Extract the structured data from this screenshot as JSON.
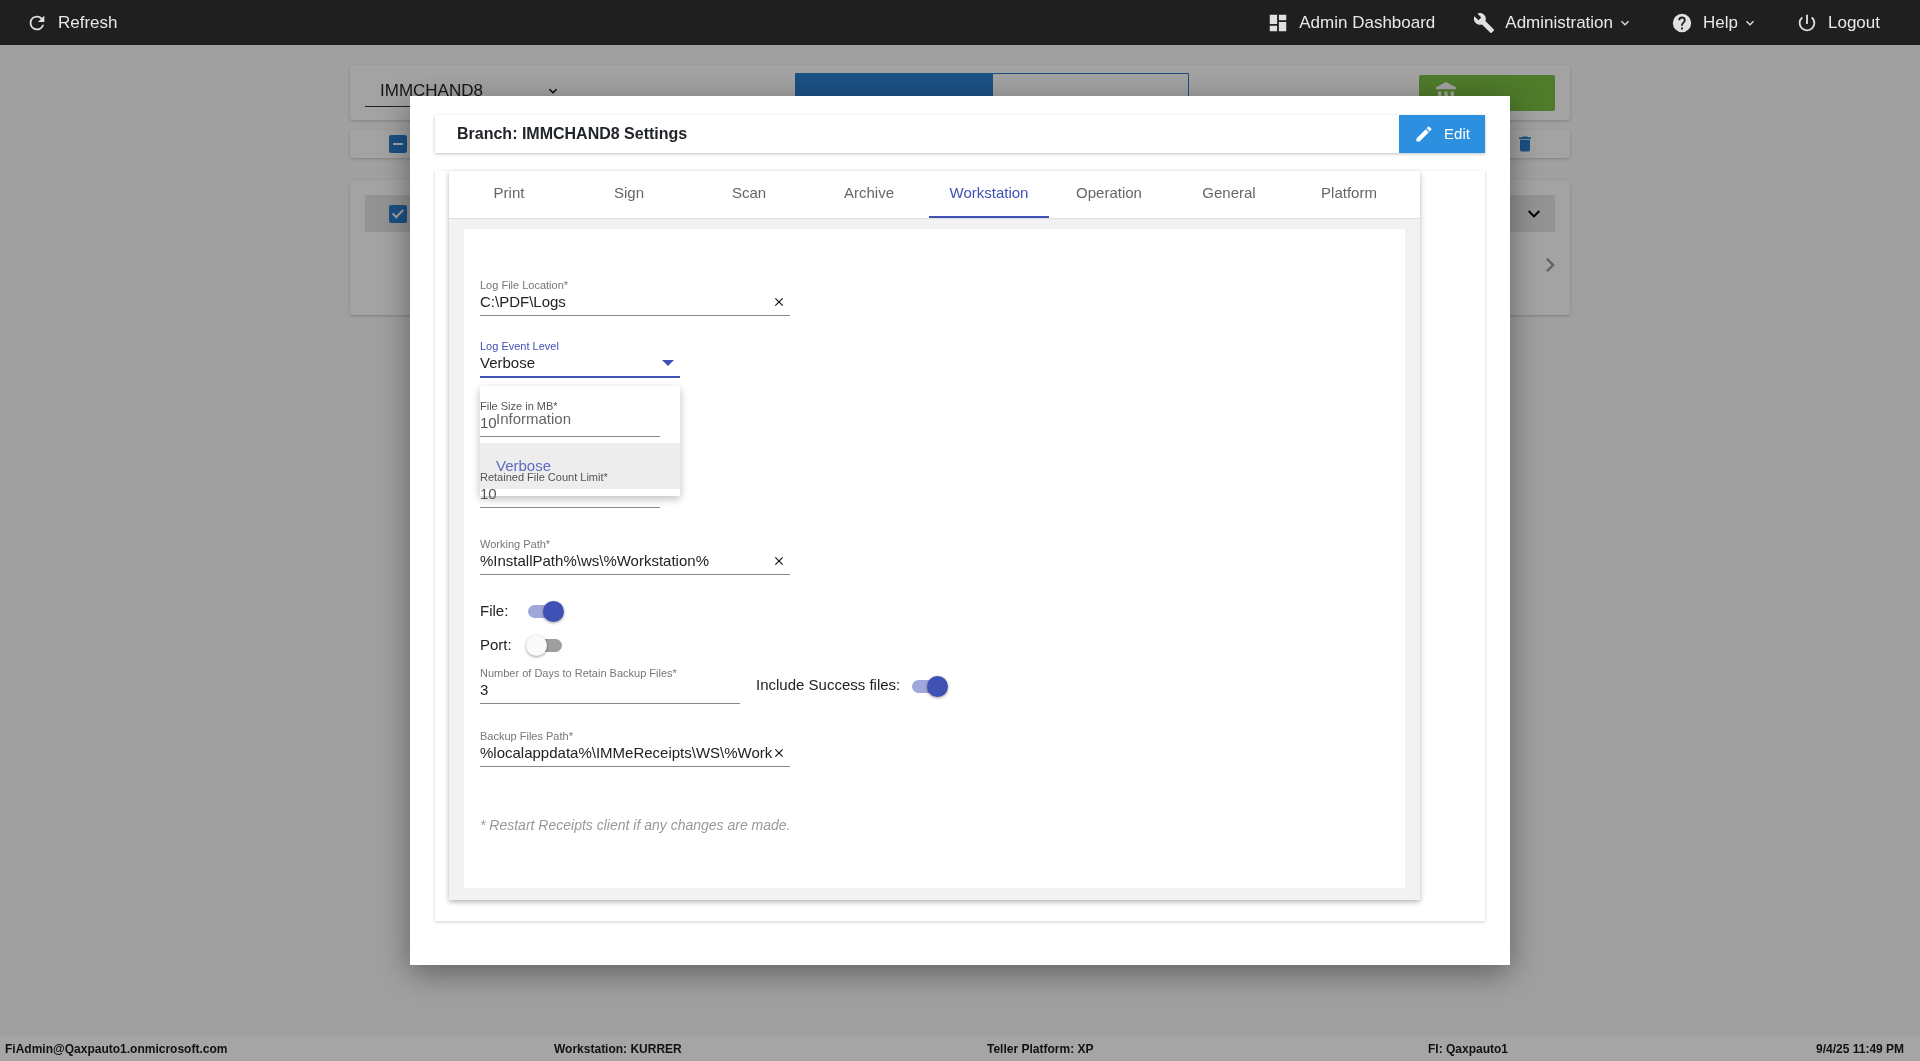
{
  "top_bar": {
    "left": [
      {
        "label": "Refresh"
      }
    ],
    "right": [
      {
        "label": "Admin Dashboard",
        "kind": "link"
      },
      {
        "label": "Administration",
        "kind": "menu"
      },
      {
        "label": "Help",
        "kind": "menu"
      },
      {
        "label": "Logout",
        "kind": "link"
      }
    ]
  },
  "background": {
    "branch_select": "IMMCHAND8",
    "view_tabs": [
      {
        "selected": true
      },
      {
        "selected": false
      }
    ],
    "select_all": {
      "indeterminate": true
    },
    "row": {
      "checked": true
    }
  },
  "dialog": {
    "title": "Branch: IMMCHAND8 Settings",
    "edit_button": "Edit",
    "tabs": [
      {
        "label": "Print",
        "selected": false
      },
      {
        "label": "Sign",
        "selected": false
      },
      {
        "label": "Scan",
        "selected": false
      },
      {
        "label": "Archive",
        "selected": false
      },
      {
        "label": "Workstation",
        "selected": true
      },
      {
        "label": "Operation",
        "selected": false
      },
      {
        "label": "General",
        "selected": false
      },
      {
        "label": "Platform",
        "selected": false
      }
    ],
    "fields": [
      {
        "kind": "text",
        "label": "Log File Location*",
        "value": "C:\\PDF\\Logs",
        "clearable": true
      },
      {
        "kind": "select",
        "label": "Log Event Level",
        "value": "Verbose",
        "expanded": true,
        "options": [
          {
            "label": "Information",
            "selected": false
          },
          {
            "label": "Verbose",
            "selected": true
          }
        ]
      },
      {
        "kind": "number",
        "label": "File Size in MB*",
        "value": "10",
        "clearable": false
      },
      {
        "kind": "number",
        "label": "Retained File Count Limit*",
        "value": "10",
        "clearable": false
      },
      {
        "kind": "text",
        "label": "Working Path*",
        "value": "%InstallPath%\\ws\\%Workstation%",
        "clearable": true
      },
      {
        "kind": "toggle",
        "label": "File:",
        "on": true
      },
      {
        "kind": "toggle",
        "label": "Port:",
        "on": false
      },
      {
        "kind": "days",
        "label": "Number of Days to Retain Backup Files*",
        "value": "3",
        "toggle": {
          "label": "Include Success files:",
          "on": true
        }
      },
      {
        "kind": "text",
        "label": "Backup Files Path*",
        "value": "%localappdata%\\IMMeReceipts\\WS\\%Work",
        "clearable": true
      }
    ],
    "note": "* Restart Receipts client if any changes are made."
  },
  "status_bar": [
    {
      "label": "FiAdmin@Qaxpauto1.onmicrosoft.com"
    },
    {
      "label": "Workstation: KURRER"
    },
    {
      "label": "Teller Platform: XP"
    },
    {
      "label": "FI: Qaxpauto1"
    },
    {
      "label": "9/4/25 11:49 PM"
    }
  ]
}
